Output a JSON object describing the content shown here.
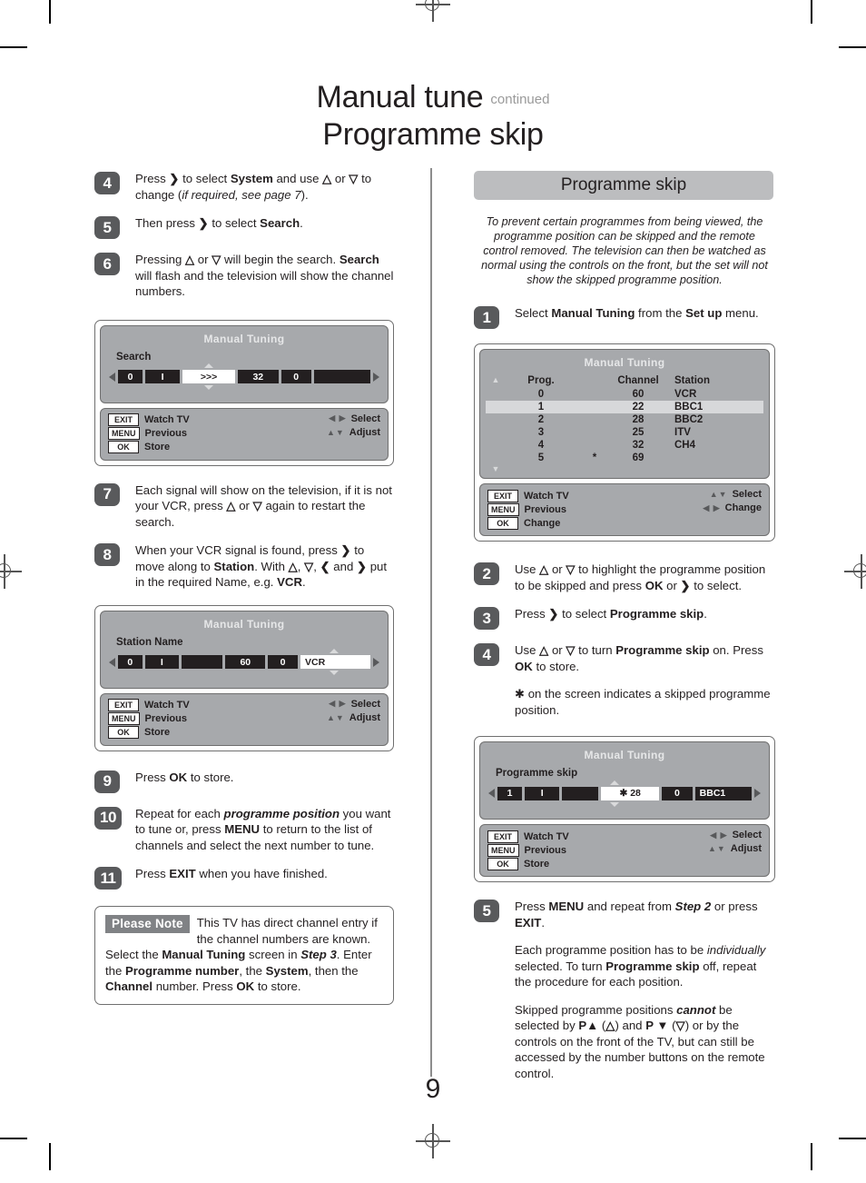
{
  "page": {
    "title_main": "Manual tune",
    "title_continued": "continued",
    "title_sub": "Programme skip",
    "page_number": "9"
  },
  "left_column": {
    "steps": [
      {
        "num": "4",
        "html": "Press <b>&#10095;</b> to select <b>System</b> and use <b>&#9651;</b> or <b>&#9661;</b> to change (<i>if required, see page 7</i>)."
      },
      {
        "num": "5",
        "html": "Then press <b>&#10095;</b> to select <b>Search</b>."
      },
      {
        "num": "6",
        "html": "Pressing <b>&#9651;</b> or <b>&#9661;</b> will begin the search. <b>Search</b> will flash and the television will show the channel numbers."
      },
      {
        "num": "7",
        "html": "Each signal will show on the television, if it is not your VCR, press <b>&#9651;</b> or <b>&#9661;</b> again to restart the search."
      },
      {
        "num": "8",
        "html": "When your VCR signal is found, press <b>&#10095;</b> to move along to <b>Station</b>. With <b>&#9651;</b>, <b>&#9661;</b>, <b>&#10094;</b> and <b>&#10095;</b> put in the required Name, e.g. <b>VCR</b>."
      },
      {
        "num": "9",
        "html": "Press <b>OK</b> to store."
      },
      {
        "num": "10",
        "html": "Repeat for each <span class='bi'>programme position</span> you want to tune or, press <b>MENU</b> to return to the list of channels and select the next number to tune."
      },
      {
        "num": "11",
        "html": "Press <b>EXIT</b> when you have finished."
      }
    ],
    "screen_search": {
      "title": "Manual Tuning",
      "label": "Search",
      "fields": [
        "0",
        "I",
        ">>>",
        "32",
        "0",
        ""
      ],
      "footer": {
        "keys": [
          {
            "key": "EXIT",
            "action": "Watch TV"
          },
          {
            "key": "MENU",
            "action": "Previous"
          },
          {
            "key": "OK",
            "action": "Store"
          }
        ],
        "right": [
          {
            "arrows": "◀ ▶",
            "label": "Select"
          },
          {
            "arrows": "▲▼",
            "label": "Adjust"
          }
        ]
      }
    },
    "screen_station": {
      "title": "Manual Tuning",
      "label": "Station Name",
      "fields": [
        "0",
        "I",
        "",
        "60",
        "0",
        "VCR"
      ],
      "footer": {
        "keys": [
          {
            "key": "EXIT",
            "action": "Watch TV"
          },
          {
            "key": "MENU",
            "action": "Previous"
          },
          {
            "key": "OK",
            "action": "Store"
          }
        ],
        "right": [
          {
            "arrows": "◀ ▶",
            "label": "Select"
          },
          {
            "arrows": "▲▼",
            "label": "Adjust"
          }
        ]
      }
    },
    "please_note": {
      "badge": "Please Note",
      "html": "This TV has direct channel entry if the channel numbers are known. Select the <b>Manual Tuning</b> screen in <span class='bi'>Step 3</span>. Enter the <b>Programme number</b>, the <b>System</b>, then the <b>Channel</b> number. Press <b>OK</b> to store."
    }
  },
  "right_column": {
    "banner": "Programme skip",
    "intro": "To prevent certain programmes from being viewed, the programme position can be skipped and the remote control removed. The television can then be watched as normal using the controls on the front, but the set will not show the skipped programme position.",
    "steps_top": [
      {
        "num": "1",
        "html": "Select <b>Manual Tuning</b> from the <b>Set up</b> menu."
      }
    ],
    "steps_mid": [
      {
        "num": "2",
        "html": "Use <b>&#9651;</b> or <b>&#9661;</b> to highlight the programme position to be skipped and press <b>OK</b> or <b>&#10095;</b> to select."
      },
      {
        "num": "3",
        "html": "Press <b>&#10095;</b> to select <b>Programme skip</b>."
      },
      {
        "num": "4",
        "html": "Use <b>&#9651;</b> or <b>&#9661;</b> to turn <b>Programme skip</b> on. Press <b>OK</b> to store."
      }
    ],
    "asterisk_note": "✱ on the screen indicates a skipped programme position.",
    "steps_bottom": [
      {
        "num": "5",
        "html": "Press <b>MENU</b> and repeat from <span class='bi'>Step 2</span> or press <b>EXIT</b>."
      }
    ],
    "closing_paragraphs": [
      "Each programme position has to be <i>individually</i> selected. To turn <b>Programme skip</b> off, repeat the procedure for each position.",
      "Skipped programme positions <span class='bi'>cannot</span> be selected by <b>P&#9650;</b> (<b>&#9651;</b>) and <b>P &#9660;</b> (<b>&#9661;</b>) or by the controls on the front of the TV, but can still be accessed by the number buttons on the remote control."
    ],
    "screen_list": {
      "title": "Manual Tuning",
      "headers": [
        "Prog.",
        "Channel",
        "Station"
      ],
      "rows": [
        {
          "prog": "0",
          "star": "",
          "channel": "60",
          "station": "VCR",
          "selected": false
        },
        {
          "prog": "1",
          "star": "",
          "channel": "22",
          "station": "BBC1",
          "selected": true
        },
        {
          "prog": "2",
          "star": "",
          "channel": "28",
          "station": "BBC2",
          "selected": false
        },
        {
          "prog": "3",
          "star": "",
          "channel": "25",
          "station": "ITV",
          "selected": false
        },
        {
          "prog": "4",
          "star": "",
          "channel": "32",
          "station": "CH4",
          "selected": false
        },
        {
          "prog": "5",
          "star": "*",
          "channel": "69",
          "station": "",
          "selected": false
        }
      ],
      "footer": {
        "keys": [
          {
            "key": "EXIT",
            "action": "Watch TV"
          },
          {
            "key": "MENU",
            "action": "Previous"
          },
          {
            "key": "OK",
            "action": "Change"
          }
        ],
        "right": [
          {
            "arrows": "▲▼",
            "label": "Select"
          },
          {
            "arrows": "◀ ▶",
            "label": "Change"
          }
        ]
      }
    },
    "screen_skip": {
      "title": "Manual Tuning",
      "label": "Programme skip",
      "fields": [
        "1",
        "I",
        "",
        "✱   28",
        "0",
        "BBC1"
      ],
      "footer": {
        "keys": [
          {
            "key": "EXIT",
            "action": "Watch TV"
          },
          {
            "key": "MENU",
            "action": "Previous"
          },
          {
            "key": "OK",
            "action": "Store"
          }
        ],
        "right": [
          {
            "arrows": "◀ ▶",
            "label": "Select"
          },
          {
            "arrows": "▲▼",
            "label": "Adjust"
          }
        ]
      }
    }
  },
  "colors": {
    "badge": "#595a5c",
    "screen": "#a7a9ac",
    "banner": "#bcbdbf",
    "text": "#231f20"
  }
}
